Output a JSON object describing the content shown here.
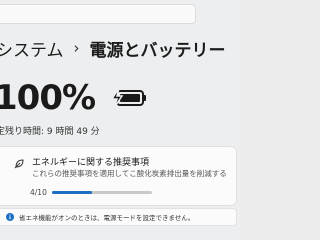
{
  "header": {
    "breadcrumb_parent": "システム",
    "breadcrumb_separator": "›",
    "breadcrumb_current": "電源とバッテリー"
  },
  "battery": {
    "percent_text": "100%",
    "charge_level": 1.0,
    "remaining_label": "定残り時間:",
    "remaining_value": "9 時間 49 分"
  },
  "energy_card": {
    "title": "エネルギーに関する推奨事項",
    "description": "これらの推奨事項を適用してこ酸化炭素排出量を削減する",
    "progress_text": "4/10",
    "progress_fraction": 0.4
  },
  "notice": {
    "text": "省エネ機能がオンのときは、電源モードを設定できません。"
  },
  "colors": {
    "accent": "#1a6fc4",
    "background": "#eceeef",
    "card": "#fbfbfb"
  }
}
